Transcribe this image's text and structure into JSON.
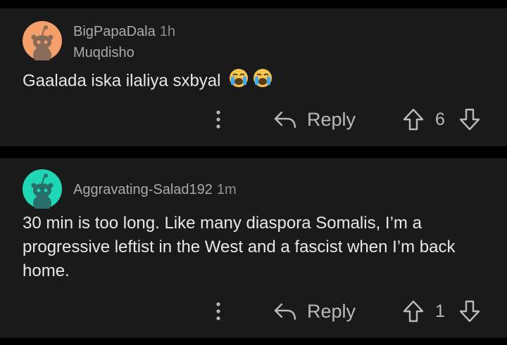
{
  "comments": [
    {
      "username": "BigPapaDala",
      "time": "1h",
      "flair": "Muqdisho",
      "text": "Gaalada iska ilaliya sxbyal",
      "avatar_color": "#f5a06a",
      "emoji": "loudly-crying-face",
      "reply_label": "Reply",
      "votes": "6"
    },
    {
      "username": "Aggravating-Salad192",
      "time": "1m",
      "text": "30 min is too long. Like many diaspora Somalis, I’m a progressive leftist in the West and a fascist when I’m back home.",
      "avatar_color": "#1dd7b5",
      "reply_label": "Reply",
      "votes": "1"
    }
  ],
  "icons": [
    "more-vertical-icon",
    "reply-arrow-icon",
    "upvote-arrow-icon",
    "downvote-arrow-icon",
    "snoo-avatar-icon"
  ],
  "colors": {
    "background": "#000000",
    "card": "#1a1a1b",
    "text": "#e8e8e8",
    "muted": "#a8aaab"
  }
}
